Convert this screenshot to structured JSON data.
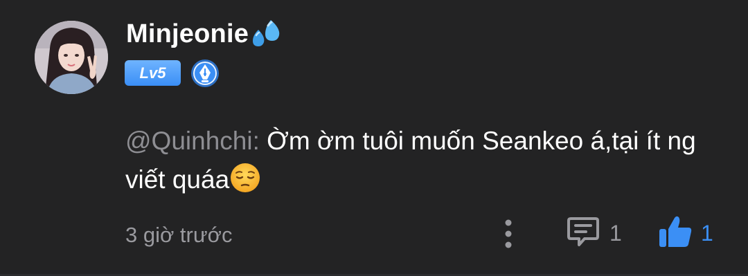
{
  "comment": {
    "user": {
      "name": "Minjeonie",
      "name_emoji": "sweat-droplets-icon",
      "level": "Lv5",
      "badge": "fountain-pen-badge-icon"
    },
    "mention": "@Quinhchi:",
    "text": " Ờm ờm tuôi muốn Seankeo á,tại ít ng viết quáa",
    "text_emoji": "pensive-face-icon",
    "timestamp": "3 giờ trước",
    "actions": {
      "more_icon": "vertical-ellipsis-icon",
      "reply_icon": "comment-icon",
      "reply_count": "1",
      "like_icon": "thumbs-up-icon",
      "like_count": "1"
    }
  },
  "colors": {
    "background": "#232324",
    "accent": "#3b8ff5",
    "muted_text": "#9a9a9f",
    "level_badge": "#4a9bf8"
  }
}
